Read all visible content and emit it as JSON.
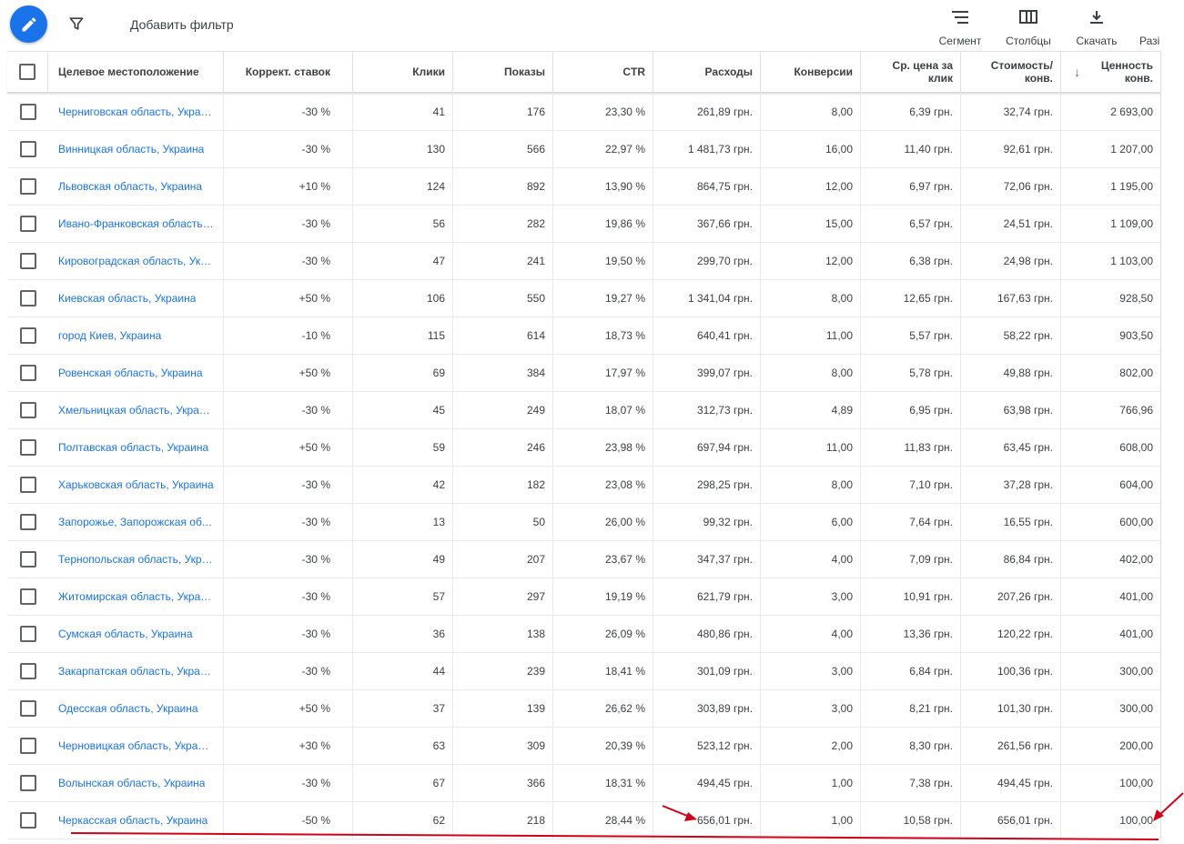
{
  "toolbar": {
    "add_filter": "Добавить фильтр",
    "segment": "Сегмент",
    "columns": "Столбцы",
    "download": "Скачать",
    "more": "Разі"
  },
  "table": {
    "headers": {
      "location": "Целевое местоположение",
      "bid_adj": "Коррект. ставок",
      "clicks": "Клики",
      "impressions": "Показы",
      "ctr": "CTR",
      "cost": "Расходы",
      "conversions": "Конверсии",
      "avg_cpc_1": "Ср. цена за",
      "avg_cpc_2": "клик",
      "cost_conv_1": "Стоимость/",
      "cost_conv_2": "конв.",
      "conv_value_1": "Ценность",
      "conv_value_2": "конв.",
      "sort_arrow": "↓"
    },
    "rows": [
      {
        "location": "Черниговская область, Украина",
        "bid_adj": "-30 %",
        "clicks": "41",
        "impressions": "176",
        "ctr": "23,30 %",
        "cost": "261,89 грн.",
        "conversions": "8,00",
        "avg_cpc": "6,39 грн.",
        "cost_conv": "32,74 грн.",
        "conv_value": "2 693,00"
      },
      {
        "location": "Винницкая область, Украина",
        "bid_adj": "-30 %",
        "clicks": "130",
        "impressions": "566",
        "ctr": "22,97 %",
        "cost": "1 481,73 грн.",
        "conversions": "16,00",
        "avg_cpc": "11,40 грн.",
        "cost_conv": "92,61 грн.",
        "conv_value": "1 207,00"
      },
      {
        "location": "Львовская область, Украина",
        "bid_adj": "+10 %",
        "clicks": "124",
        "impressions": "892",
        "ctr": "13,90 %",
        "cost": "864,75 грн.",
        "conversions": "12,00",
        "avg_cpc": "6,97 грн.",
        "cost_conv": "72,06 грн.",
        "conv_value": "1 195,00"
      },
      {
        "location": "Ивано-Франковская область, Украина",
        "bid_adj": "-30 %",
        "clicks": "56",
        "impressions": "282",
        "ctr": "19,86 %",
        "cost": "367,66 грн.",
        "conversions": "15,00",
        "avg_cpc": "6,57 грн.",
        "cost_conv": "24,51 грн.",
        "conv_value": "1 109,00"
      },
      {
        "location": "Кировоградская область, Украина",
        "bid_adj": "-30 %",
        "clicks": "47",
        "impressions": "241",
        "ctr": "19,50 %",
        "cost": "299,70 грн.",
        "conversions": "12,00",
        "avg_cpc": "6,38 грн.",
        "cost_conv": "24,98 грн.",
        "conv_value": "1 103,00"
      },
      {
        "location": "Киевская область, Украина",
        "bid_adj": "+50 %",
        "clicks": "106",
        "impressions": "550",
        "ctr": "19,27 %",
        "cost": "1 341,04 грн.",
        "conversions": "8,00",
        "avg_cpc": "12,65 грн.",
        "cost_conv": "167,63 грн.",
        "conv_value": "928,50"
      },
      {
        "location": "город Киев, Украина",
        "bid_adj": "-10 %",
        "clicks": "115",
        "impressions": "614",
        "ctr": "18,73 %",
        "cost": "640,41 грн.",
        "conversions": "11,00",
        "avg_cpc": "5,57 грн.",
        "cost_conv": "58,22 грн.",
        "conv_value": "903,50"
      },
      {
        "location": "Ровенская область, Украина",
        "bid_adj": "+50 %",
        "clicks": "69",
        "impressions": "384",
        "ctr": "17,97 %",
        "cost": "399,07 грн.",
        "conversions": "8,00",
        "avg_cpc": "5,78 грн.",
        "cost_conv": "49,88 грн.",
        "conv_value": "802,00"
      },
      {
        "location": "Хмельницкая область, Украина",
        "bid_adj": "-30 %",
        "clicks": "45",
        "impressions": "249",
        "ctr": "18,07 %",
        "cost": "312,73 грн.",
        "conversions": "4,89",
        "avg_cpc": "6,95 грн.",
        "cost_conv": "63,98 грн.",
        "conv_value": "766,96"
      },
      {
        "location": "Полтавская область, Украина",
        "bid_adj": "+50 %",
        "clicks": "59",
        "impressions": "246",
        "ctr": "23,98 %",
        "cost": "697,94 грн.",
        "conversions": "11,00",
        "avg_cpc": "11,83 грн.",
        "cost_conv": "63,45 грн.",
        "conv_value": "608,00"
      },
      {
        "location": "Харьковская область, Украина",
        "bid_adj": "-30 %",
        "clicks": "42",
        "impressions": "182",
        "ctr": "23,08 %",
        "cost": "298,25 грн.",
        "conversions": "8,00",
        "avg_cpc": "7,10 грн.",
        "cost_conv": "37,28 грн.",
        "conv_value": "604,00"
      },
      {
        "location": "Запорожье, Запорожская область, Украина",
        "bid_adj": "-30 %",
        "clicks": "13",
        "impressions": "50",
        "ctr": "26,00 %",
        "cost": "99,32 грн.",
        "conversions": "6,00",
        "avg_cpc": "7,64 грн.",
        "cost_conv": "16,55 грн.",
        "conv_value": "600,00"
      },
      {
        "location": "Тернопольская область, Украина",
        "bid_adj": "-30 %",
        "clicks": "49",
        "impressions": "207",
        "ctr": "23,67 %",
        "cost": "347,37 грн.",
        "conversions": "4,00",
        "avg_cpc": "7,09 грн.",
        "cost_conv": "86,84 грн.",
        "conv_value": "402,00"
      },
      {
        "location": "Житомирская область, Украина",
        "bid_adj": "-30 %",
        "clicks": "57",
        "impressions": "297",
        "ctr": "19,19 %",
        "cost": "621,79 грн.",
        "conversions": "3,00",
        "avg_cpc": "10,91 грн.",
        "cost_conv": "207,26 грн.",
        "conv_value": "401,00"
      },
      {
        "location": "Сумская область, Украина",
        "bid_adj": "-30 %",
        "clicks": "36",
        "impressions": "138",
        "ctr": "26,09 %",
        "cost": "480,86 грн.",
        "conversions": "4,00",
        "avg_cpc": "13,36 грн.",
        "cost_conv": "120,22 грн.",
        "conv_value": "401,00"
      },
      {
        "location": "Закарпатская область, Украина",
        "bid_adj": "-30 %",
        "clicks": "44",
        "impressions": "239",
        "ctr": "18,41 %",
        "cost": "301,09 грн.",
        "conversions": "3,00",
        "avg_cpc": "6,84 грн.",
        "cost_conv": "100,36 грн.",
        "conv_value": "300,00"
      },
      {
        "location": "Одесская область, Украина",
        "bid_adj": "+50 %",
        "clicks": "37",
        "impressions": "139",
        "ctr": "26,62 %",
        "cost": "303,89 грн.",
        "conversions": "3,00",
        "avg_cpc": "8,21 грн.",
        "cost_conv": "101,30 грн.",
        "conv_value": "300,00"
      },
      {
        "location": "Черновицкая область, Украина",
        "bid_adj": "+30 %",
        "clicks": "63",
        "impressions": "309",
        "ctr": "20,39 %",
        "cost": "523,12 грн.",
        "conversions": "2,00",
        "avg_cpc": "8,30 грн.",
        "cost_conv": "261,56 грн.",
        "conv_value": "200,00"
      },
      {
        "location": "Волынская область, Украина",
        "bid_adj": "-30 %",
        "clicks": "67",
        "impressions": "366",
        "ctr": "18,31 %",
        "cost": "494,45 грн.",
        "conversions": "1,00",
        "avg_cpc": "7,38 грн.",
        "cost_conv": "494,45 грн.",
        "conv_value": "100,00"
      },
      {
        "location": "Черкасская область, Украина",
        "bid_adj": "-50 %",
        "clicks": "62",
        "impressions": "218",
        "ctr": "28,44 %",
        "cost": "656,01 грн.",
        "conversions": "1,00",
        "avg_cpc": "10,58 грн.",
        "cost_conv": "656,01 грн.",
        "conv_value": "100,00"
      }
    ]
  },
  "colors": {
    "accent": "#1a73e8",
    "link": "#1a73e8",
    "annotation": "#d0021b"
  }
}
